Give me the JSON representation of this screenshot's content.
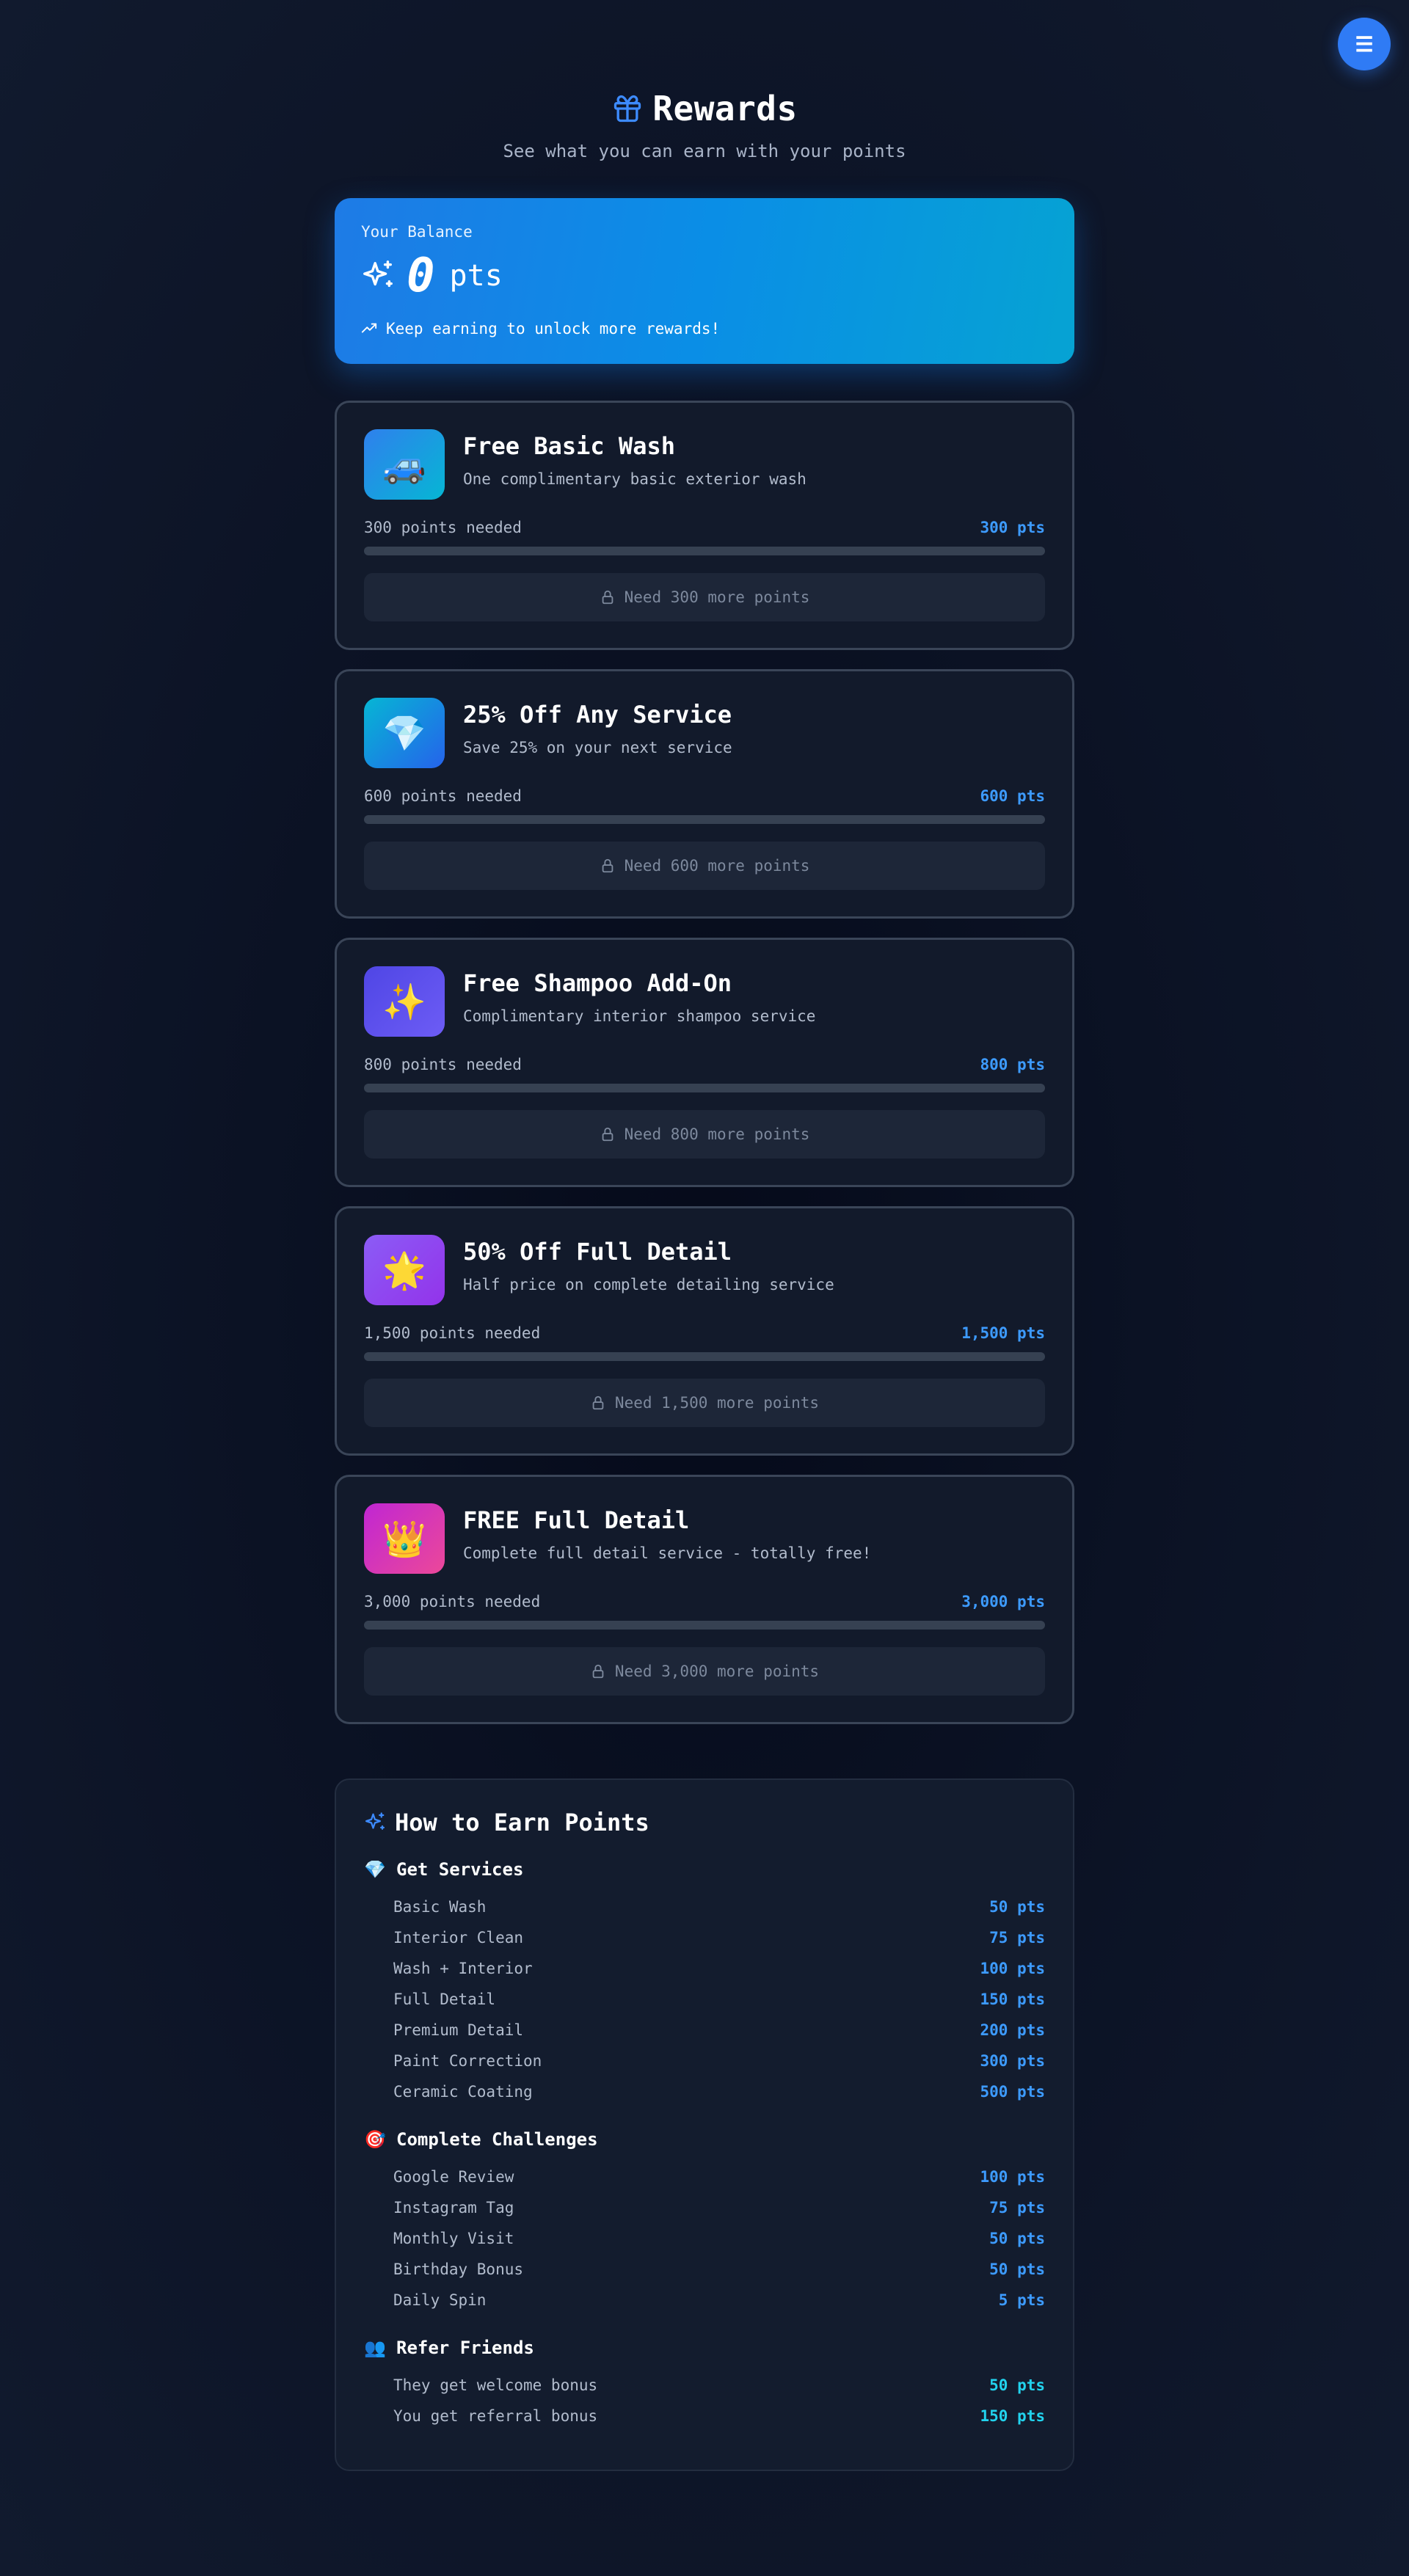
{
  "menu": {
    "icon": "menu-icon",
    "glyph": "☰"
  },
  "header": {
    "title": "Rewards",
    "subtitle": "See what you can earn with your points",
    "icon": "gift-icon"
  },
  "balance": {
    "label": "Your Balance",
    "value": "0",
    "unit": "pts",
    "hint": "Keep earning to unlock more rewards!",
    "icon": "sparkle-icon",
    "hint_icon": "trending-up-icon"
  },
  "colors": {
    "accent": "#3d9bff",
    "balance_gradient_start": "#1e7be6",
    "balance_gradient_end": "#06a3d3",
    "background": "#0b1224",
    "card": "#121a2b"
  },
  "rewards": [
    {
      "emoji": "🚙",
      "icon_name": "car-icon",
      "gradient": [
        "#2f80ed",
        "#06b6d4"
      ],
      "title": "Free Basic Wash",
      "description": "One complimentary basic exterior wash",
      "needed_label": "300 points needed",
      "needed_pts": "300 pts",
      "progress": 0,
      "button_label": "Need 300 more points"
    },
    {
      "emoji": "💎",
      "icon_name": "gem-icon",
      "gradient": [
        "#06b6d4",
        "#2563eb"
      ],
      "title": "25% Off Any Service",
      "description": "Save 25% on your next service",
      "needed_label": "600 points needed",
      "needed_pts": "600 pts",
      "progress": 0,
      "button_label": "Need 600 more points"
    },
    {
      "emoji": "✨",
      "icon_name": "sparkles-icon",
      "gradient": [
        "#4f46e5",
        "#6d5cf5"
      ],
      "title": "Free Shampoo Add-On",
      "description": "Complimentary interior shampoo service",
      "needed_label": "800 points needed",
      "needed_pts": "800 pts",
      "progress": 0,
      "button_label": "Need 800 more points"
    },
    {
      "emoji": "🌟",
      "icon_name": "star-icon",
      "gradient": [
        "#8b5cf6",
        "#9333ea"
      ],
      "title": "50% Off Full Detail",
      "description": "Half price on complete detailing service",
      "needed_label": "1,500 points needed",
      "needed_pts": "1,500 pts",
      "progress": 0,
      "button_label": "Need 1,500 more points"
    },
    {
      "emoji": "👑",
      "icon_name": "crown-icon",
      "gradient": [
        "#c026d3",
        "#ec4899"
      ],
      "title": "FREE Full Detail",
      "description": "Complete full detail service - totally free!",
      "needed_label": "3,000 points needed",
      "needed_pts": "3,000 pts",
      "progress": 0,
      "button_label": "Need 3,000 more points"
    }
  ],
  "earn": {
    "title": "How to Earn Points",
    "icon": "sparkle-icon",
    "sections": [
      {
        "emoji": "💎",
        "icon_name": "gem-icon",
        "title": "Get Services",
        "items": [
          {
            "label": "Basic Wash",
            "pts": "50 pts"
          },
          {
            "label": "Interior Clean",
            "pts": "75 pts"
          },
          {
            "label": "Wash + Interior",
            "pts": "100 pts"
          },
          {
            "label": "Full Detail",
            "pts": "150 pts"
          },
          {
            "label": "Premium Detail",
            "pts": "200 pts"
          },
          {
            "label": "Paint Correction",
            "pts": "300 pts"
          },
          {
            "label": "Ceramic Coating",
            "pts": "500 pts"
          }
        ]
      },
      {
        "emoji": "🎯",
        "icon_name": "target-icon",
        "title": "Complete Challenges",
        "items": [
          {
            "label": "Google Review",
            "pts": "100 pts"
          },
          {
            "label": "Instagram Tag",
            "pts": "75 pts"
          },
          {
            "label": "Monthly Visit",
            "pts": "50 pts"
          },
          {
            "label": "Birthday Bonus",
            "pts": "50 pts"
          },
          {
            "label": "Daily Spin",
            "pts": "5 pts"
          }
        ]
      },
      {
        "emoji": "👥",
        "icon_name": "people-icon",
        "title": "Refer Friends",
        "items": [
          {
            "label": "They get welcome bonus",
            "pts": "50 pts",
            "accent": "cyan"
          },
          {
            "label": "You get referral bonus",
            "pts": "150 pts",
            "accent": "cyan"
          }
        ]
      }
    ]
  }
}
